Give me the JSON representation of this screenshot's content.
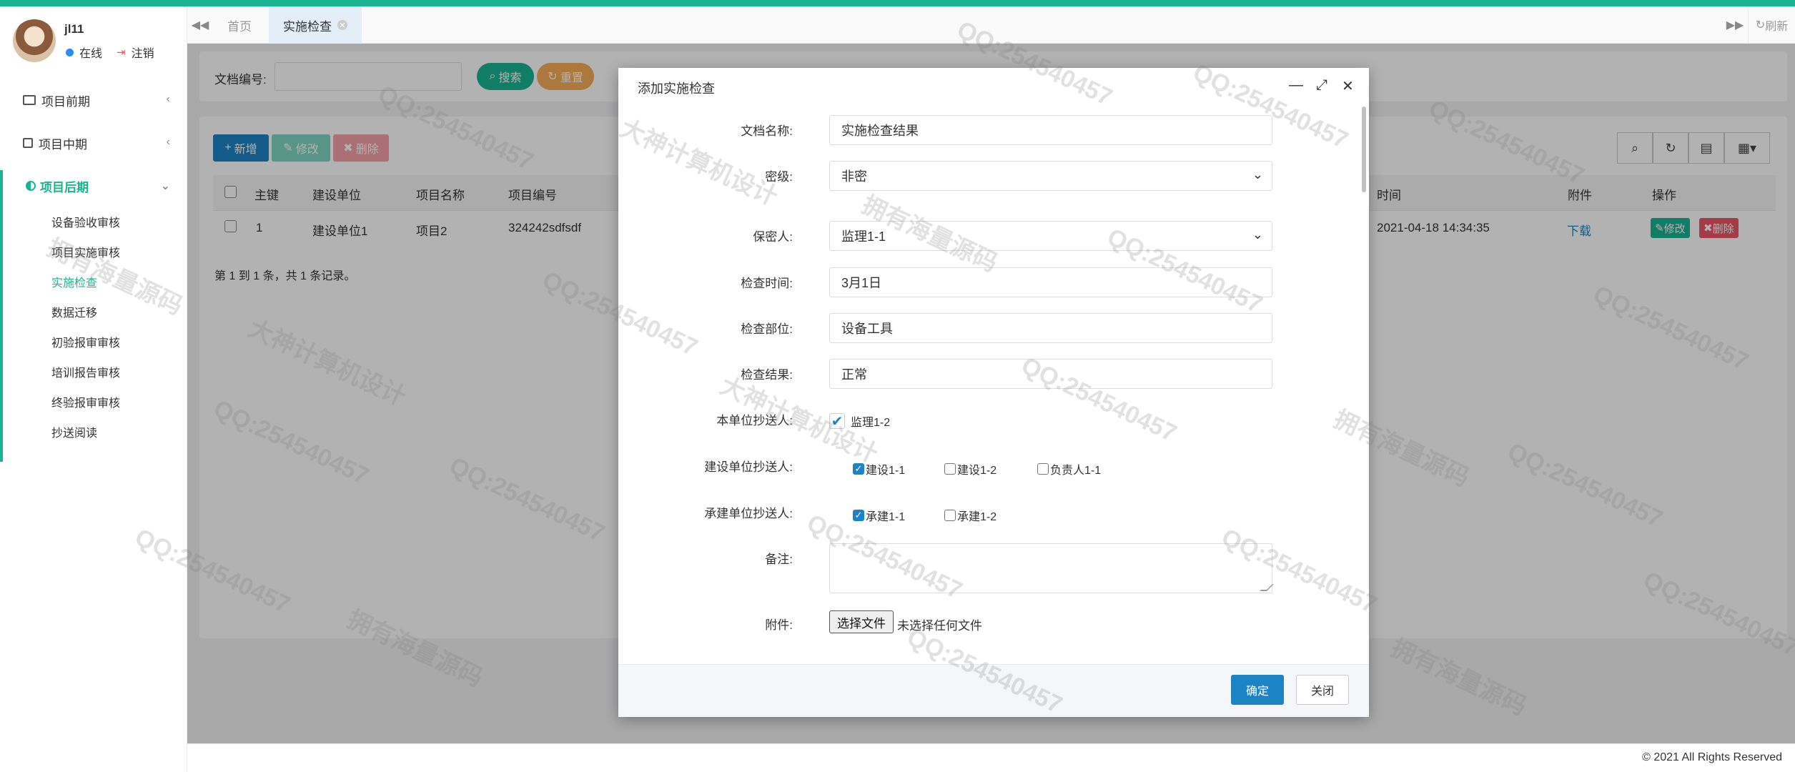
{
  "colors": {
    "accent": "#1ab394",
    "primary": "#1c84c6",
    "danger": "#ed5565",
    "warning": "#f8ac59"
  },
  "user": {
    "name": "jl11",
    "status": "在线",
    "logout": "注销"
  },
  "sidebar": {
    "groups": [
      {
        "label": "项目前期"
      },
      {
        "label": "项目中期"
      },
      {
        "label": "项目后期"
      }
    ],
    "subitems": [
      {
        "label": "设备验收审核"
      },
      {
        "label": "项目实施审核"
      },
      {
        "label": "实施检查"
      },
      {
        "label": "数据迁移"
      },
      {
        "label": "初验报审审核"
      },
      {
        "label": "培训报告审核"
      },
      {
        "label": "终验报审审核"
      },
      {
        "label": "抄送阅读"
      }
    ]
  },
  "tabs": {
    "home": "首页",
    "current": "实施检查",
    "refresh": "刷新"
  },
  "search": {
    "label": "文档编号:",
    "value": "",
    "search_btn": "搜索",
    "reset_btn": "重置"
  },
  "toolbar": {
    "add": "新增",
    "edit": "修改",
    "delete": "删除"
  },
  "table": {
    "headers": [
      "主键",
      "建设单位",
      "项目名称",
      "项目编号",
      "时间",
      "附件",
      "操作"
    ],
    "rows": [
      {
        "id": "1",
        "unit": "建设单位1",
        "project": "项目2",
        "code": "324242sdfsdf",
        "time": "2021-04-18 14:34:35",
        "attachment": "下载",
        "edit": "修改",
        "delete": "删除"
      }
    ],
    "pagination": "第 1 到 1 条，共 1 条记录。"
  },
  "modal": {
    "title": "添加实施检查",
    "fields": {
      "doc_name_label": "文档名称:",
      "doc_name_value": "实施检查结果",
      "level_label": "密级:",
      "level_value": "非密",
      "secret_label": "保密人:",
      "secret_value": "监理1-1",
      "time_label": "检查时间:",
      "time_value": "3月1日",
      "part_label": "检查部位:",
      "part_value": "设备工具",
      "result_label": "检查结果:",
      "result_value": "正常",
      "cc_own_label": "本单位抄送人:",
      "cc_own_option": "监理1-2",
      "cc_build_label": "建设单位抄送人:",
      "cc_build_options": [
        "建设1-1",
        "建设1-2",
        "负责人1-1"
      ],
      "cc_contract_label": "承建单位抄送人:",
      "cc_contract_options": [
        "承建1-1",
        "承建1-2"
      ],
      "remark_label": "备注:",
      "attach_label": "附件:",
      "file_btn": "选择文件",
      "file_text": "未选择任何文件"
    },
    "ok": "确定",
    "close": "关闭"
  },
  "footer": "© 2021 All Rights Reserved",
  "watermarks": [
    "QQ:254540457",
    "大神计算机设计",
    "拥有海量源码"
  ]
}
